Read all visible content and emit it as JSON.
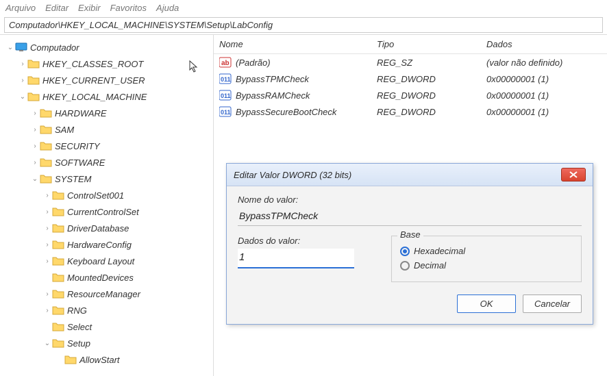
{
  "menu": {
    "items": [
      "Arquivo",
      "Editar",
      "Exibir",
      "Favoritos",
      "Ajuda"
    ]
  },
  "address": "Computador\\HKEY_LOCAL_MACHINE\\SYSTEM\\Setup\\LabConfig",
  "tree": [
    {
      "ind": 0,
      "t": "v",
      "icon": "pc",
      "label": "Computador"
    },
    {
      "ind": 1,
      "t": ">",
      "icon": "f",
      "label": "HKEY_CLASSES_ROOT"
    },
    {
      "ind": 1,
      "t": ">",
      "icon": "f",
      "label": "HKEY_CURRENT_USER"
    },
    {
      "ind": 1,
      "t": "v",
      "icon": "f",
      "label": "HKEY_LOCAL_MACHINE"
    },
    {
      "ind": 2,
      "t": ">",
      "icon": "f",
      "label": "HARDWARE"
    },
    {
      "ind": 2,
      "t": ">",
      "icon": "f",
      "label": "SAM"
    },
    {
      "ind": 2,
      "t": ">",
      "icon": "f",
      "label": "SECURITY"
    },
    {
      "ind": 2,
      "t": ">",
      "icon": "f",
      "label": "SOFTWARE"
    },
    {
      "ind": 2,
      "t": "v",
      "icon": "f",
      "label": "SYSTEM"
    },
    {
      "ind": 3,
      "t": ">",
      "icon": "f",
      "label": "ControlSet001"
    },
    {
      "ind": 3,
      "t": ">",
      "icon": "f",
      "label": "CurrentControlSet"
    },
    {
      "ind": 3,
      "t": ">",
      "icon": "f",
      "label": "DriverDatabase"
    },
    {
      "ind": 3,
      "t": ">",
      "icon": "f",
      "label": "HardwareConfig"
    },
    {
      "ind": 3,
      "t": ">",
      "icon": "f",
      "label": "Keyboard Layout"
    },
    {
      "ind": 3,
      "t": "",
      "icon": "f",
      "label": "MountedDevices"
    },
    {
      "ind": 3,
      "t": ">",
      "icon": "f",
      "label": "ResourceManager"
    },
    {
      "ind": 3,
      "t": ">",
      "icon": "f",
      "label": "RNG"
    },
    {
      "ind": 3,
      "t": "",
      "icon": "f",
      "label": "Select"
    },
    {
      "ind": 3,
      "t": "v",
      "icon": "f",
      "label": "Setup"
    },
    {
      "ind": 4,
      "t": "",
      "icon": "f",
      "label": "AllowStart"
    }
  ],
  "columns": {
    "name": "Nome",
    "type": "Tipo",
    "data": "Dados"
  },
  "values": [
    {
      "icon": "ab",
      "name": "(Padrão)",
      "type": "REG_SZ",
      "data": "(valor não definido)"
    },
    {
      "icon": "dw",
      "name": "BypassTPMCheck",
      "type": "REG_DWORD",
      "data": "0x00000001 (1)"
    },
    {
      "icon": "dw",
      "name": "BypassRAMCheck",
      "type": "REG_DWORD",
      "data": "0x00000001 (1)"
    },
    {
      "icon": "dw",
      "name": "BypassSecureBootCheck",
      "type": "REG_DWORD",
      "data": "0x00000001 (1)"
    }
  ],
  "dialog": {
    "title": "Editar Valor DWORD (32 bits)",
    "name_label": "Nome do valor:",
    "name_value": "BypassTPMCheck",
    "data_label": "Dados do valor:",
    "data_value": "1",
    "base_label": "Base",
    "hex_label": "Hexadecimal",
    "dec_label": "Decimal",
    "ok": "OK",
    "cancel": "Cancelar"
  }
}
